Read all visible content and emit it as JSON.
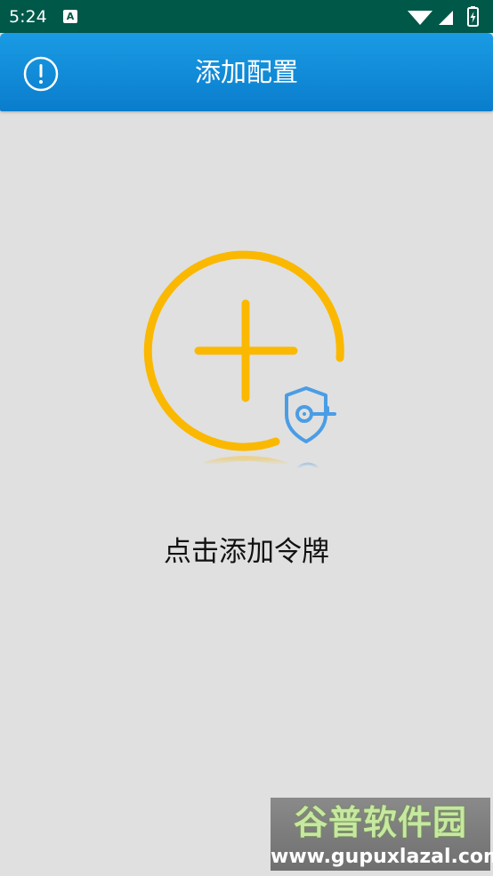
{
  "status_bar": {
    "time": "5:24",
    "notification_letter": "A",
    "icons": [
      "wifi-icon",
      "signal-icon",
      "battery-charging-icon"
    ]
  },
  "app_bar": {
    "title": "添加配置",
    "info_icon": "info-circle-icon"
  },
  "main": {
    "add_token_icon": "add-token-icon",
    "add_token_label": "点击添加令牌"
  },
  "watermark": {
    "name": "谷普软件园",
    "url": "www.gupuxlazal.com"
  },
  "colors": {
    "status_bar": "#005849",
    "app_bar": "#1a9be4",
    "background": "#e0e0e0",
    "accent_yellow": "#fbb800",
    "shield_blue": "#4a9de5"
  }
}
